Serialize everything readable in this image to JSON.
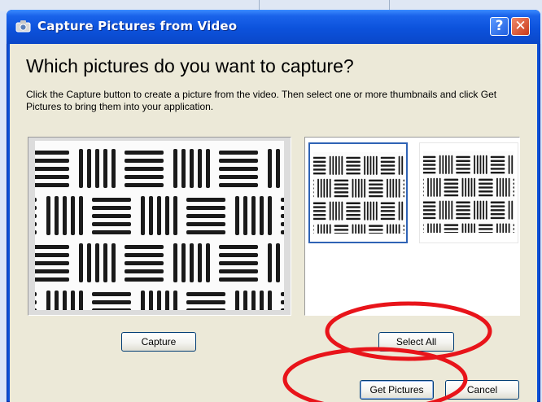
{
  "window": {
    "title": "Capture Pictures from Video",
    "help_glyph": "?",
    "close_glyph": "✕"
  },
  "dialog": {
    "heading": "Which pictures do you want to capture?",
    "description": "Click the Capture button to create a picture from the video.  Then select one or more thumbnails and click Get Pictures to bring them into your application."
  },
  "buttons": {
    "capture": "Capture",
    "select_all": "Select All",
    "get_pictures": "Get Pictures",
    "cancel": "Cancel"
  },
  "thumbnails": [
    {
      "selected": true
    },
    {
      "selected": false
    }
  ],
  "annotations": {
    "color": "#e8141a",
    "highlighted": [
      "Select All",
      "Get Pictures"
    ]
  },
  "theme": {
    "title_bar": "#0a4fd6",
    "dialog_face": "#ece9d8",
    "selection_border": "#2f63b5"
  }
}
